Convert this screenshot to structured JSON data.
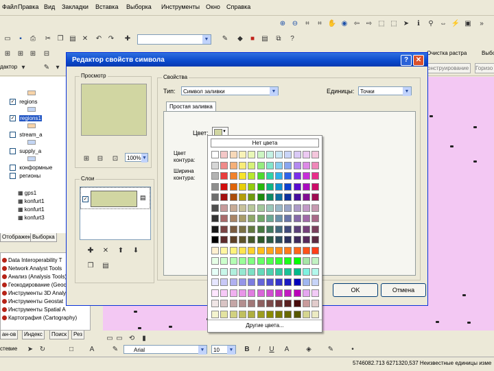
{
  "menu": [
    "Файл",
    "Правка",
    "Вид",
    "Закладки",
    "Вставка",
    "Выборка",
    "Инструменты",
    "Окно",
    "Справка"
  ],
  "toolbar": {
    "raster_cleanup": "Очистка растра",
    "raster_right": "Выбор",
    "construct_combo": "онструирование",
    "gor_combo": "Горизо",
    "editor": "дактор"
  },
  "toc": {
    "rows": [
      "regions",
      "regions1",
      "stream_a",
      "supply_a",
      "конформные",
      "регионы",
      "gps1",
      "konfurt1",
      "konfurt1",
      "konfurt3"
    ],
    "tabs": [
      "Отображение",
      "Выборка"
    ]
  },
  "toolbox": {
    "rows": [
      "Data Interoperability T",
      "Network Analyst Tools",
      "Анализ (Analysis Tools)",
      "Геокодирование (Geoco",
      "Инструменты 3D Analy",
      "Инструменты Geostat",
      "Инструменты Spatial A",
      "Картография (Cartography)"
    ],
    "tabs": [
      "ан-ов",
      "Индекс",
      "Поиск",
      "Рез"
    ]
  },
  "dialog": {
    "title": "Редактор свойств символа",
    "preview_label": "Просмотр",
    "zoom": "100%",
    "layers_label": "Слои",
    "properties_label": "Свойства",
    "type_label": "Тип:",
    "type_value": "Символ заливки",
    "units_label": "Единицы:",
    "units_value": "Точки",
    "tab": "Простая заливка",
    "color_label": "Цвет:",
    "outline_color_label": "Цвет контура:",
    "outline_width_label": "Ширина контура:",
    "ok": "OK",
    "cancel": "Отмена"
  },
  "palette": {
    "no_color": "Нет цвета",
    "more_colors": "Другие цвета...",
    "rows": [
      [
        "#ffffff",
        "#f4c7c7",
        "#f7d8b8",
        "#f8f2b8",
        "#e9f8b8",
        "#cdf5c2",
        "#c4f1e4",
        "#c9e6f5",
        "#c9d4f7",
        "#d9c9f5",
        "#ecc9f2",
        "#f4c6dc"
      ],
      [
        "#d6d6d6",
        "#f08a8a",
        "#f5b079",
        "#f8ec79",
        "#d6f279",
        "#97ec7f",
        "#84e6cb",
        "#86cdef",
        "#89a6f0",
        "#b38af0",
        "#dd8ae6",
        "#ef87b9"
      ],
      [
        "#b3b3b3",
        "#e83d3d",
        "#f2812b",
        "#f8e42b",
        "#b8e82e",
        "#4fdb2e",
        "#2ed4a8",
        "#2eb0ea",
        "#2e63ea",
        "#7b2eea",
        "#c72ed9",
        "#e82e8a"
      ],
      [
        "#8f8f8f",
        "#d10e0e",
        "#e06409",
        "#e8cf0a",
        "#93cc0d",
        "#27b80c",
        "#0cb585",
        "#0c8fd0",
        "#0c41d0",
        "#5a0cd0",
        "#a90cbf",
        "#cc0c69"
      ],
      [
        "#6e6e6e",
        "#a31010",
        "#ab4d0a",
        "#b39e0a",
        "#6e9a0d",
        "#1c8a0d",
        "#0d8964",
        "#0d6c9e",
        "#0d319e",
        "#450d9e",
        "#820d92",
        "#9e0d51"
      ],
      [
        "#4f4f4f",
        "#c79b9b",
        "#c7ab96",
        "#c7c19a",
        "#b7c79a",
        "#a2c79a",
        "#9ac7b9",
        "#9ab7c7",
        "#9aa4c7",
        "#ad9ac7",
        "#c29ac7",
        "#c79ab1"
      ],
      [
        "#333333",
        "#a86a6a",
        "#a88466",
        "#a89c69",
        "#8fa869",
        "#70a869",
        "#69a893",
        "#6990a8",
        "#6974a8",
        "#8669a8",
        "#a069a8",
        "#a86988"
      ],
      [
        "#1a1a1a",
        "#7a4444",
        "#7a5b40",
        "#7a7044",
        "#62793f",
        "#467940",
        "#40795f",
        "#40667a",
        "#40497a",
        "#5b407a",
        "#74407a",
        "#7a405c"
      ],
      [
        "#000000",
        "#5c2a2a",
        "#5c3f26",
        "#5c532a",
        "#45592a",
        "#2d592a",
        "#2a5944",
        "#2a4a5c",
        "#2a305c",
        "#3e2a5c",
        "#562a5c",
        "#5c2a41"
      ],
      [
        "#fff0d0",
        "#fff6a0",
        "#fff27a",
        "#ffe44f",
        "#ffd12a",
        "#ffbf1a",
        "#ffa41a",
        "#ff8c1a",
        "#ff7a1a",
        "#ff661a",
        "#ff521a",
        "#ff3e1a"
      ],
      [
        "#e6ffe6",
        "#ccffcc",
        "#b3ffb3",
        "#99ff99",
        "#80ff80",
        "#66ff66",
        "#4dff4d",
        "#33ff33",
        "#1aff1a",
        "#00ff00",
        "#a6e6a6",
        "#c2f2c2"
      ],
      [
        "#e6fff7",
        "#c9f7e9",
        "#b0f0dd",
        "#96e8d1",
        "#7de0c5",
        "#66d9ba",
        "#4dd1ae",
        "#33c9a2",
        "#1ac296",
        "#00ba8a",
        "#7ff2e0",
        "#b3f8ec"
      ],
      [
        "#e6e6ff",
        "#c9c9f7",
        "#b0b0f0",
        "#9696e8",
        "#7d7de0",
        "#6666d9",
        "#4d4dd1",
        "#3333c9",
        "#1a1ac2",
        "#0000ba",
        "#9fb6f0",
        "#c7d4f8"
      ],
      [
        "#ffe6ff",
        "#f7c9f7",
        "#f0b0f0",
        "#e896e8",
        "#e07de0",
        "#d966d9",
        "#d14dd1",
        "#c933c9",
        "#c21ac2",
        "#ba00ba",
        "#e5a6f0",
        "#f2caf6"
      ],
      [
        "#f0e6e6",
        "#d9c4c4",
        "#c4a6a6",
        "#b38f8f",
        "#a17878",
        "#8f6161",
        "#7d4b4b",
        "#6b3535",
        "#592020",
        "#470b0b",
        "#c99b9b",
        "#e2cccc"
      ],
      [
        "#f4f4cf",
        "#e3e3a1",
        "#d1d180",
        "#c0c060",
        "#aeae40",
        "#9d9d20",
        "#8b8b00",
        "#7a7a00",
        "#686800",
        "#575700",
        "#d5d590",
        "#ecebc3"
      ]
    ]
  },
  "bottom": {
    "draw_label": "стевие",
    "font": "Arial",
    "font_size": "10",
    "coords": "5746082.713  6271320,537 Неизвестные единицы изме"
  }
}
